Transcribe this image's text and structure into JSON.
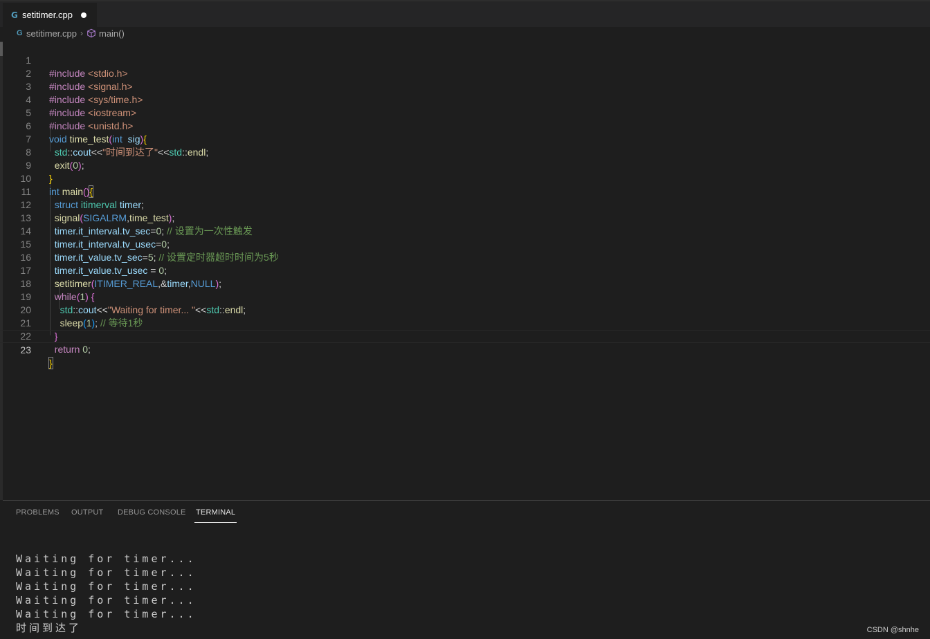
{
  "tab": {
    "filename": "setitimer.cpp"
  },
  "breadcrumb": {
    "file": "setitimer.cpp",
    "symbol": "main()"
  },
  "editor": {
    "line_numbers": [
      "1",
      "2",
      "3",
      "4",
      "5",
      "6",
      "7",
      "8",
      "9",
      "10",
      "11",
      "12",
      "13",
      "14",
      "15",
      "16",
      "17",
      "18",
      "19",
      "20",
      "21",
      "22",
      "23"
    ],
    "current_line": 23
  },
  "code_tokens": {
    "include": "#include",
    "h_stdio": "<stdio.h>",
    "h_signal": "<signal.h>",
    "h_systime": "<sys/time.h>",
    "h_iostream": "<iostream>",
    "h_unistd": "<unistd.h>",
    "kw_void": "void",
    "fn_time_test": "time_test",
    "kw_int": "int",
    "param_sig": "sig",
    "ns_std": "std",
    "op_scope": "::",
    "var_cout": "cout",
    "var_endl": "endl",
    "op_shift": "<<",
    "str_time_up": "\"时间到达了\"",
    "fn_exit": "exit",
    "num_0": "0",
    "num_1": "1",
    "num_5": "5",
    "fn_main": "main",
    "kw_struct": "struct",
    "type_itimerval": "itimerval",
    "var_timer": "timer",
    "fn_signal": "signal",
    "mac_sigalrm": "SIGALRM",
    "expr_interval_sec": "timer.it_interval.tv_sec",
    "expr_interval_usec": "timer.it_interval.tv_usec",
    "expr_value_sec": "timer.it_value.tv_sec",
    "expr_value_usec": "timer.it_value.tv_usec",
    "cm_once": "// 设置为一次性触发",
    "cm_timeout": "// 设置定时器超时时间为5秒",
    "fn_setitimer": "setitimer",
    "mac_itimer_real": "ITIMER_REAL",
    "mac_null": "NULL",
    "kw_while": "while",
    "str_waiting": "\"Waiting for timer... \"",
    "fn_sleep": "sleep",
    "cm_wait": "// 等待1秒",
    "kw_return": "return"
  },
  "panel": {
    "tabs": [
      "PROBLEMS",
      "OUTPUT",
      "DEBUG CONSOLE",
      "TERMINAL"
    ],
    "active_tab": "TERMINAL"
  },
  "terminal": {
    "lines": [
      "Waiting for timer...",
      "Waiting for timer...",
      "Waiting for timer...",
      "Waiting for timer...",
      "Waiting for timer...",
      "时间到达了"
    ]
  },
  "watermark": "CSDN @shnhe",
  "colors": {
    "editor_bg": "#1e1e1e",
    "keyword": "#569cd6",
    "preprocessor": "#c586c0",
    "string": "#ce9178",
    "function": "#dcdcaa",
    "namespace": "#4ec9b0",
    "variable": "#9cdcfe",
    "number": "#b5cea8",
    "comment": "#6a9955"
  }
}
